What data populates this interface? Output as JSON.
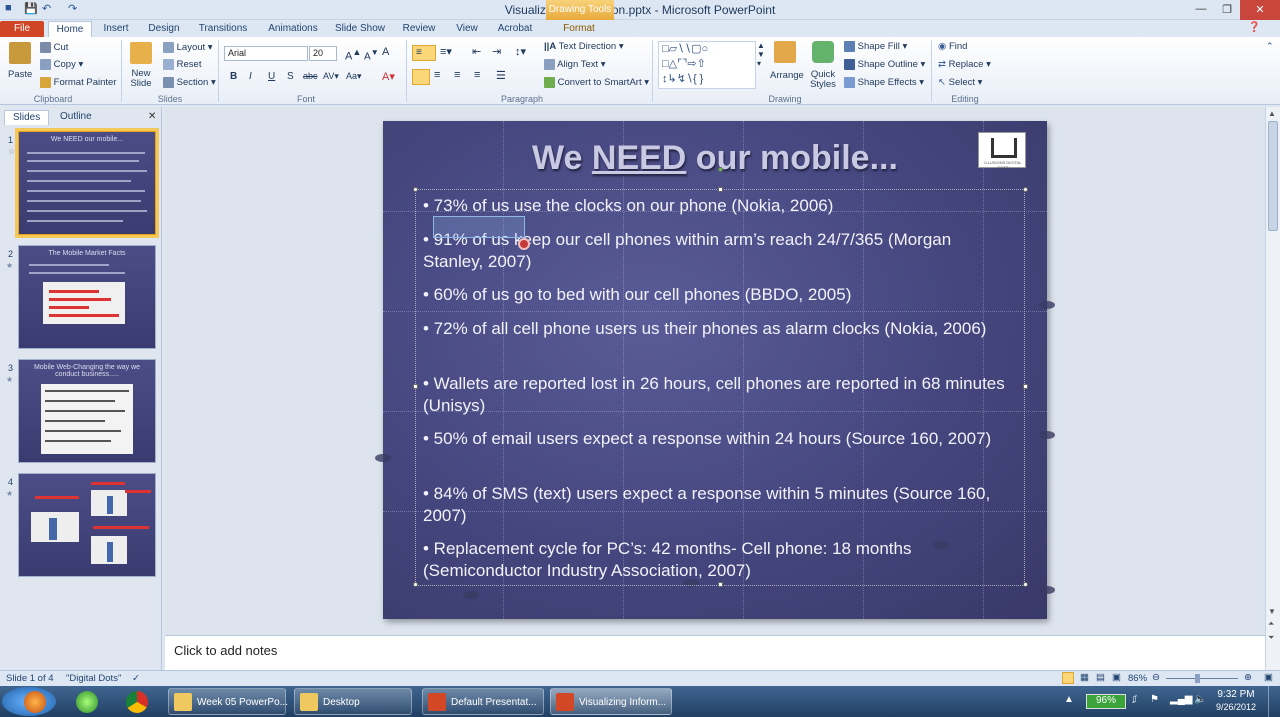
{
  "window": {
    "title": "Visualizing Information.pptx  -  Microsoft PowerPoint",
    "context_tab": "Drawing Tools"
  },
  "tabs": [
    "File",
    "Home",
    "Insert",
    "Design",
    "Transitions",
    "Animations",
    "Slide Show",
    "Review",
    "View",
    "Acrobat",
    "Format"
  ],
  "ribbon": {
    "clipboard": {
      "paste": "Paste",
      "cut": "Cut",
      "copy": "Copy",
      "format_painter": "Format Painter",
      "label": "Clipboard"
    },
    "slides": {
      "new_slide": "New Slide",
      "layout": "Layout",
      "reset": "Reset",
      "section": "Section",
      "label": "Slides"
    },
    "font": {
      "family": "Arial",
      "size": "20",
      "label": "Font"
    },
    "paragraph": {
      "text_direction": "Text Direction",
      "align_text": "Align Text",
      "smartart": "Convert to SmartArt",
      "label": "Paragraph"
    },
    "drawing": {
      "arrange": "Arrange",
      "quick_styles": "Quick Styles",
      "shape_fill": "Shape Fill",
      "shape_outline": "Shape Outline",
      "shape_effects": "Shape Effects",
      "label": "Drawing"
    },
    "editing": {
      "find": "Find",
      "replace": "Replace",
      "select": "Select",
      "label": "Editing"
    }
  },
  "panel": {
    "tabs": [
      "Slides",
      "Outline"
    ]
  },
  "thumbnails": [
    {
      "num": "1",
      "title": "We NEED our mobile..."
    },
    {
      "num": "2",
      "title": "The Mobile Market  Facts"
    },
    {
      "num": "3",
      "title": "Mobile Web-Changing the way we conduct business....."
    },
    {
      "num": "4",
      "title": ""
    }
  ],
  "slide": {
    "title_pre": "We ",
    "title_emph": "NEED",
    "title_post": " our mobile...",
    "logo_text": "ILLUSIONS  DIGITAL  DOTS",
    "bullets": [
      "• 73% of us use the clocks on our phone (Nokia, 2006)",
      "• 91% of us keep our cell phones within arm’s reach 24/7/365 (Morgan Stanley, 2007)",
      "• 60% of us go to bed with our cell phones (BBDO, 2005)",
      "• 72% of all cell phone users us their phones as alarm clocks (Nokia, 2006)",
      "• Wallets are reported lost in 26 hours, cell phones are reported in 68 minutes (Unisys)",
      "• 50% of email users expect a response within 24 hours (Source 160, 2007)",
      "• 84% of SMS (text) users expect a response within 5 minutes (Source 160, 2007)",
      "• Replacement cycle for PC’s: 42 months- Cell phone: 18 months (Semiconductor Industry Association, 2007)"
    ]
  },
  "notes": {
    "placeholder": "Click to add notes"
  },
  "status": {
    "slide": "Slide 1 of 4",
    "theme": "\"Digital Dots\"",
    "zoom": "86%"
  },
  "taskbar": {
    "items": [
      "Week 05 PowerPo...",
      "Desktop",
      "Default Presentat...",
      "Visualizing Inform..."
    ],
    "battery": "96%",
    "time": "9:32 PM",
    "date": "9/26/2012"
  },
  "colors": {
    "file_tab": "#d04526",
    "slide_bg": "#45467e",
    "accent": "#f5c85a"
  }
}
